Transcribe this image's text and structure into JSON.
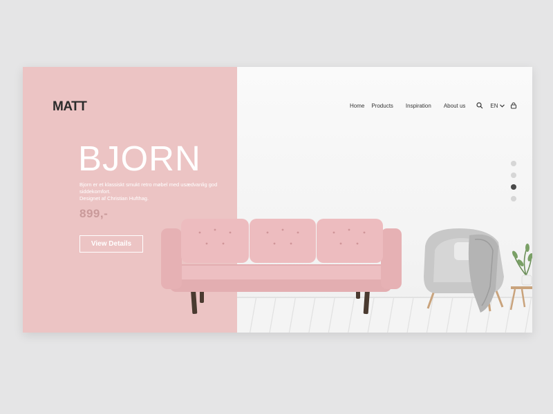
{
  "brand": {
    "logo": "MATT"
  },
  "nav": {
    "items": [
      "Home",
      "Products",
      "Inspiration",
      "About us"
    ],
    "language": "EN"
  },
  "hero": {
    "title": "BJORN",
    "description_line1": "Bjorn er et klassiskt smukt retro møbel med usædvanlig god siddekomfort.",
    "description_line2": "Designet af Christian Hufthag.",
    "price": "899,-",
    "cta_label": "View Details"
  },
  "carousel": {
    "total": 4,
    "active_index": 2
  },
  "colors": {
    "accent_pink": "#ecc4c4",
    "price_color": "#c99a9a",
    "background": "#e5e5e6"
  }
}
